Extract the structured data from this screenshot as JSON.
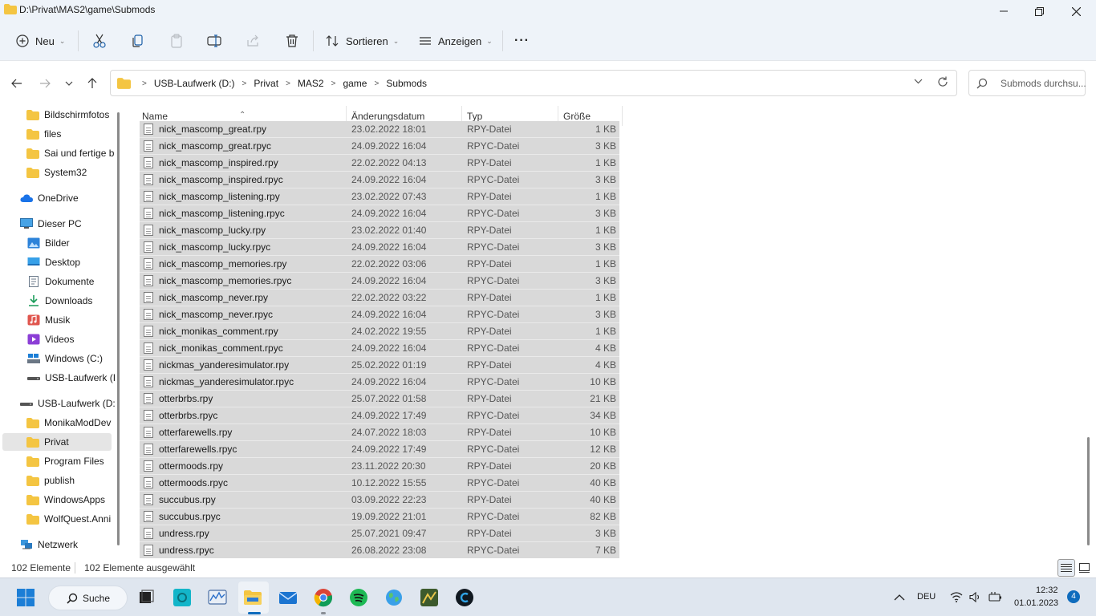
{
  "window": {
    "title": "D:\\Privat\\MAS2\\game\\Submods"
  },
  "commandbar": {
    "new_label": "Neu",
    "sort_label": "Sortieren",
    "view_label": "Anzeigen",
    "more_label": "···"
  },
  "address": {
    "crumbs": [
      "USB-Laufwerk (D:)",
      "Privat",
      "MAS2",
      "game",
      "Submods"
    ],
    "search_placeholder": "Submods durchsu..."
  },
  "sidebar": {
    "items": [
      {
        "label": "Bildschirmfotos",
        "icon": "folder-icon"
      },
      {
        "label": "files",
        "icon": "folder-icon"
      },
      {
        "label": "Sai und fertige b",
        "icon": "folder-icon"
      },
      {
        "label": "System32",
        "icon": "folder-icon"
      },
      {
        "label": "OneDrive",
        "icon": "cloud-icon"
      },
      {
        "label": "Dieser PC",
        "icon": "pc-icon"
      },
      {
        "label": "Bilder",
        "icon": "pictures-icon"
      },
      {
        "label": "Desktop",
        "icon": "desktop-icon"
      },
      {
        "label": "Dokumente",
        "icon": "documents-icon"
      },
      {
        "label": "Downloads",
        "icon": "download-icon"
      },
      {
        "label": "Musik",
        "icon": "music-icon"
      },
      {
        "label": "Videos",
        "icon": "videos-icon"
      },
      {
        "label": "Windows (C:)",
        "icon": "drive-icon"
      },
      {
        "label": "USB-Laufwerk (I",
        "icon": "usb-drive-icon"
      },
      {
        "label": "USB-Laufwerk (D:",
        "icon": "usb-drive-icon"
      },
      {
        "label": "MonikaModDev",
        "icon": "folder-icon"
      },
      {
        "label": "Privat",
        "icon": "folder-icon"
      },
      {
        "label": "Program Files",
        "icon": "folder-icon"
      },
      {
        "label": "publish",
        "icon": "folder-icon"
      },
      {
        "label": "WindowsApps",
        "icon": "folder-icon"
      },
      {
        "label": "WolfQuest.Anni",
        "icon": "folder-icon"
      },
      {
        "label": "Netzwerk",
        "icon": "network-icon"
      }
    ]
  },
  "columns": {
    "name": "Name",
    "date": "Änderungsdatum",
    "type": "Typ",
    "size": "Größe"
  },
  "files": [
    {
      "name": "nick_mascomp_great.rpy",
      "date": "23.02.2022 18:01",
      "type": "RPY-Datei",
      "size": "1 KB"
    },
    {
      "name": "nick_mascomp_great.rpyc",
      "date": "24.09.2022 16:04",
      "type": "RPYC-Datei",
      "size": "3 KB"
    },
    {
      "name": "nick_mascomp_inspired.rpy",
      "date": "22.02.2022 04:13",
      "type": "RPY-Datei",
      "size": "1 KB"
    },
    {
      "name": "nick_mascomp_inspired.rpyc",
      "date": "24.09.2022 16:04",
      "type": "RPYC-Datei",
      "size": "3 KB"
    },
    {
      "name": "nick_mascomp_listening.rpy",
      "date": "23.02.2022 07:43",
      "type": "RPY-Datei",
      "size": "1 KB"
    },
    {
      "name": "nick_mascomp_listening.rpyc",
      "date": "24.09.2022 16:04",
      "type": "RPYC-Datei",
      "size": "3 KB"
    },
    {
      "name": "nick_mascomp_lucky.rpy",
      "date": "23.02.2022 01:40",
      "type": "RPY-Datei",
      "size": "1 KB"
    },
    {
      "name": "nick_mascomp_lucky.rpyc",
      "date": "24.09.2022 16:04",
      "type": "RPYC-Datei",
      "size": "3 KB"
    },
    {
      "name": "nick_mascomp_memories.rpy",
      "date": "22.02.2022 03:06",
      "type": "RPY-Datei",
      "size": "1 KB"
    },
    {
      "name": "nick_mascomp_memories.rpyc",
      "date": "24.09.2022 16:04",
      "type": "RPYC-Datei",
      "size": "3 KB"
    },
    {
      "name": "nick_mascomp_never.rpy",
      "date": "22.02.2022 03:22",
      "type": "RPY-Datei",
      "size": "1 KB"
    },
    {
      "name": "nick_mascomp_never.rpyc",
      "date": "24.09.2022 16:04",
      "type": "RPYC-Datei",
      "size": "3 KB"
    },
    {
      "name": "nick_monikas_comment.rpy",
      "date": "24.02.2022 19:55",
      "type": "RPY-Datei",
      "size": "1 KB"
    },
    {
      "name": "nick_monikas_comment.rpyc",
      "date": "24.09.2022 16:04",
      "type": "RPYC-Datei",
      "size": "4 KB"
    },
    {
      "name": "nickmas_yanderesimulator.rpy",
      "date": "25.02.2022 01:19",
      "type": "RPY-Datei",
      "size": "4 KB"
    },
    {
      "name": "nickmas_yanderesimulator.rpyc",
      "date": "24.09.2022 16:04",
      "type": "RPYC-Datei",
      "size": "10 KB"
    },
    {
      "name": "otterbrbs.rpy",
      "date": "25.07.2022 01:58",
      "type": "RPY-Datei",
      "size": "21 KB"
    },
    {
      "name": "otterbrbs.rpyc",
      "date": "24.09.2022 17:49",
      "type": "RPYC-Datei",
      "size": "34 KB"
    },
    {
      "name": "otterfarewells.rpy",
      "date": "24.07.2022 18:03",
      "type": "RPY-Datei",
      "size": "10 KB"
    },
    {
      "name": "otterfarewells.rpyc",
      "date": "24.09.2022 17:49",
      "type": "RPYC-Datei",
      "size": "12 KB"
    },
    {
      "name": "ottermoods.rpy",
      "date": "23.11.2022 20:30",
      "type": "RPY-Datei",
      "size": "20 KB"
    },
    {
      "name": "ottermoods.rpyc",
      "date": "10.12.2022 15:55",
      "type": "RPYC-Datei",
      "size": "40 KB"
    },
    {
      "name": "succubus.rpy",
      "date": "03.09.2022 22:23",
      "type": "RPY-Datei",
      "size": "40 KB"
    },
    {
      "name": "succubus.rpyc",
      "date": "19.09.2022 21:01",
      "type": "RPYC-Datei",
      "size": "82 KB"
    },
    {
      "name": "undress.rpy",
      "date": "25.07.2021 09:47",
      "type": "RPY-Datei",
      "size": "3 KB"
    },
    {
      "name": "undress.rpyc",
      "date": "26.08.2022 23:08",
      "type": "RPYC-Datei",
      "size": "7 KB"
    }
  ],
  "status": {
    "count": "102 Elemente",
    "selected": "102 Elemente ausgewählt"
  },
  "taskbar": {
    "search_label": "Suche",
    "language": "DEU",
    "time": "12:32",
    "date": "01.01.2023",
    "notification_count": "4"
  },
  "colors": {
    "selection": "#d9d9d9",
    "folder": "#f4c542",
    "accent": "#0f6cbd"
  }
}
